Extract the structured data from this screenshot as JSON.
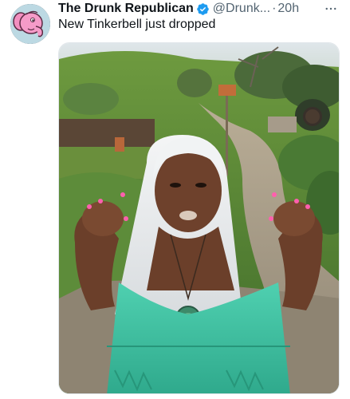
{
  "tweet": {
    "author_name": "The Drunk Republican",
    "verified_icon": "verified-badge-icon",
    "handle": "@Drunk...",
    "separator": "·",
    "time": "20h",
    "text": "New Tinkerbell just dropped",
    "more_icon": "more-options-icon"
  },
  "colors": {
    "verified_blue": "#1d9bf0",
    "secondary_text": "#536471",
    "primary_text": "#0f1419",
    "dress_teal": "#3fc7a8",
    "wig_white": "#eef0f2"
  },
  "media": {
    "avatar_icon": "pink-cartoon-elephant-avatar",
    "image_subject": "hobbit-village-scene-photo"
  }
}
